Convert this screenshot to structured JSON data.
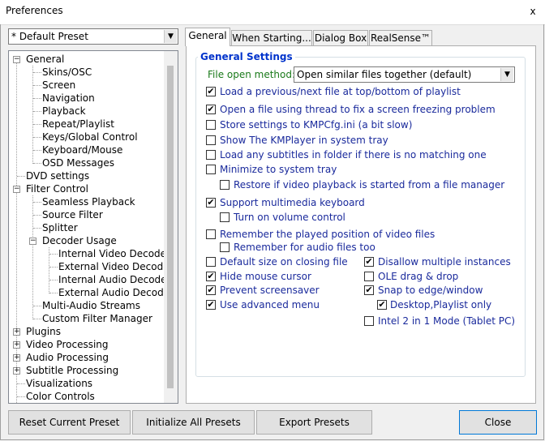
{
  "window": {
    "title": "Preferences",
    "close_label": "x"
  },
  "preset_combo": {
    "value": "* Default Preset"
  },
  "tree": [
    {
      "label": "General"
    },
    {
      "label": "Skins/OSC"
    },
    {
      "label": "Screen"
    },
    {
      "label": "Navigation"
    },
    {
      "label": "Playback"
    },
    {
      "label": "Repeat/Playlist"
    },
    {
      "label": "Keys/Global Control"
    },
    {
      "label": "Keyboard/Mouse"
    },
    {
      "label": "OSD Messages"
    },
    {
      "label": "DVD settings"
    },
    {
      "label": "Filter Control"
    },
    {
      "label": "Seamless Playback"
    },
    {
      "label": "Source Filter"
    },
    {
      "label": "Splitter"
    },
    {
      "label": "Decoder Usage"
    },
    {
      "label": "Internal Video Decoder"
    },
    {
      "label": "External Video Decoder"
    },
    {
      "label": "Internal Audio Decoder"
    },
    {
      "label": "External Audio Decoder"
    },
    {
      "label": "Multi-Audio Streams"
    },
    {
      "label": "Custom Filter Manager"
    },
    {
      "label": "Plugins"
    },
    {
      "label": "Video Processing"
    },
    {
      "label": "Audio Processing"
    },
    {
      "label": "Subtitle Processing"
    },
    {
      "label": "Visualizations"
    },
    {
      "label": "Color Controls"
    }
  ],
  "tabs": [
    {
      "label": "General"
    },
    {
      "label": "When Starting..."
    },
    {
      "label": "Dialog Box"
    },
    {
      "label": "RealSense™"
    }
  ],
  "general": {
    "group_title": "General Settings",
    "file_open_label": "File open method:",
    "file_open_value": "Open similar files together (default)",
    "options": [
      {
        "label": "Load a previous/next file at top/bottom of playlist",
        "checked": true
      },
      {
        "label": "Open a file using thread to fix a screen freezing problem",
        "checked": true
      },
      {
        "label": "Store settings to KMPCfg.ini (a bit slow)",
        "checked": false
      },
      {
        "label": "Show The KMPlayer in system tray",
        "checked": false
      },
      {
        "label": "Load any subtitles in folder if there is no matching one",
        "checked": false
      },
      {
        "label": "Minimize to system tray",
        "checked": false
      },
      {
        "label": "Restore if video playback is started from a file manager",
        "checked": false
      },
      {
        "label": "Support multimedia keyboard",
        "checked": true
      },
      {
        "label": "Turn on volume control",
        "checked": false
      },
      {
        "label": "Remember the played position of video files",
        "checked": false
      },
      {
        "label": "Remember for audio files too",
        "checked": false
      },
      {
        "label": "Default size on closing file",
        "checked": false
      },
      {
        "label": "Hide mouse cursor",
        "checked": true
      },
      {
        "label": "Prevent screensaver",
        "checked": true
      },
      {
        "label": "Use advanced menu",
        "checked": true
      },
      {
        "label": "Disallow multiple instances",
        "checked": true
      },
      {
        "label": "OLE drag & drop",
        "checked": false
      },
      {
        "label": "Snap to edge/window",
        "checked": true
      },
      {
        "label": "Desktop,Playlist only",
        "checked": true
      },
      {
        "label": "Intel 2 in 1 Mode (Tablet PC)",
        "checked": false
      }
    ]
  },
  "buttons": {
    "reset": "Reset Current Preset",
    "initialize": "Initialize All Presets",
    "export": "Export Presets",
    "close": "Close"
  }
}
